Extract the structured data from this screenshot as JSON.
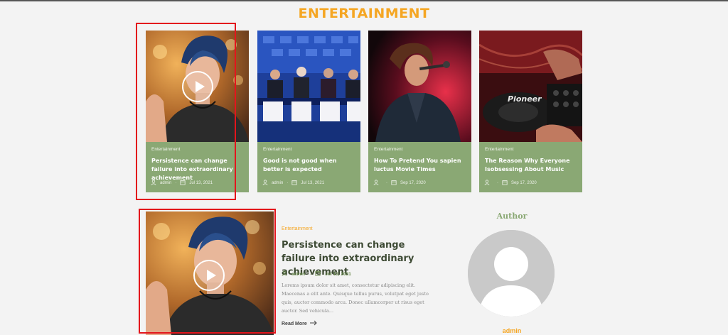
{
  "section": {
    "title": "ENTERTAINMENT"
  },
  "cards": [
    {
      "category": "Entertainment",
      "title": "Persistence can change failure into extraordinary achievement",
      "author": "admin",
      "date": "Jul 13, 2021"
    },
    {
      "category": "Entertainment",
      "title": "Good is not good when better is expected",
      "author": "admin",
      "date": "Jul 13, 2021"
    },
    {
      "category": "Entertainment",
      "title": "How To Pretend You sapien luctus Movie Times",
      "author": "",
      "date": "Sep 17, 2020"
    },
    {
      "category": "Entertainment",
      "title": "The Reason Why Everyone Isobsessing About Music",
      "author": "",
      "date": "Sep 17, 2020"
    }
  ],
  "featured": {
    "category": "Entertainment",
    "title": "Persistence can change failure into extraordinary achievement",
    "author": "admin",
    "date": "Jul 13, 2021",
    "excerpt": "Lorems ipsum dolor sit amet, consectetur adipiscing elit. Maecenas a elit ante. Quisque tellus purus, volutpat eget justo quis, auctor commodo arcu. Donec ullamcorper ut risus eget auctor. Sed vehicula...",
    "read_more": "Read More"
  },
  "author_widget": {
    "title": "Author",
    "name": "admin"
  },
  "images": {
    "card1": "woman-portrait-blue-hair-video",
    "card2": "conference-panel-speakers",
    "card3": "singer-microphone-concert",
    "card4": "dj-mixer-pioneer",
    "featured": "woman-portrait-blue-hair-video",
    "avatar": "default-user-avatar"
  },
  "icons": {
    "play": "play-icon",
    "user": "user-icon",
    "calendar": "calendar-icon",
    "arrow": "arrow-right-icon"
  },
  "colors": {
    "accent": "#f5a623",
    "card_bg": "#8aa874",
    "highlight": "#e3151c",
    "page_bg": "#f3f3f3"
  },
  "brand_text": {
    "dj_deck": "Pioneer"
  }
}
